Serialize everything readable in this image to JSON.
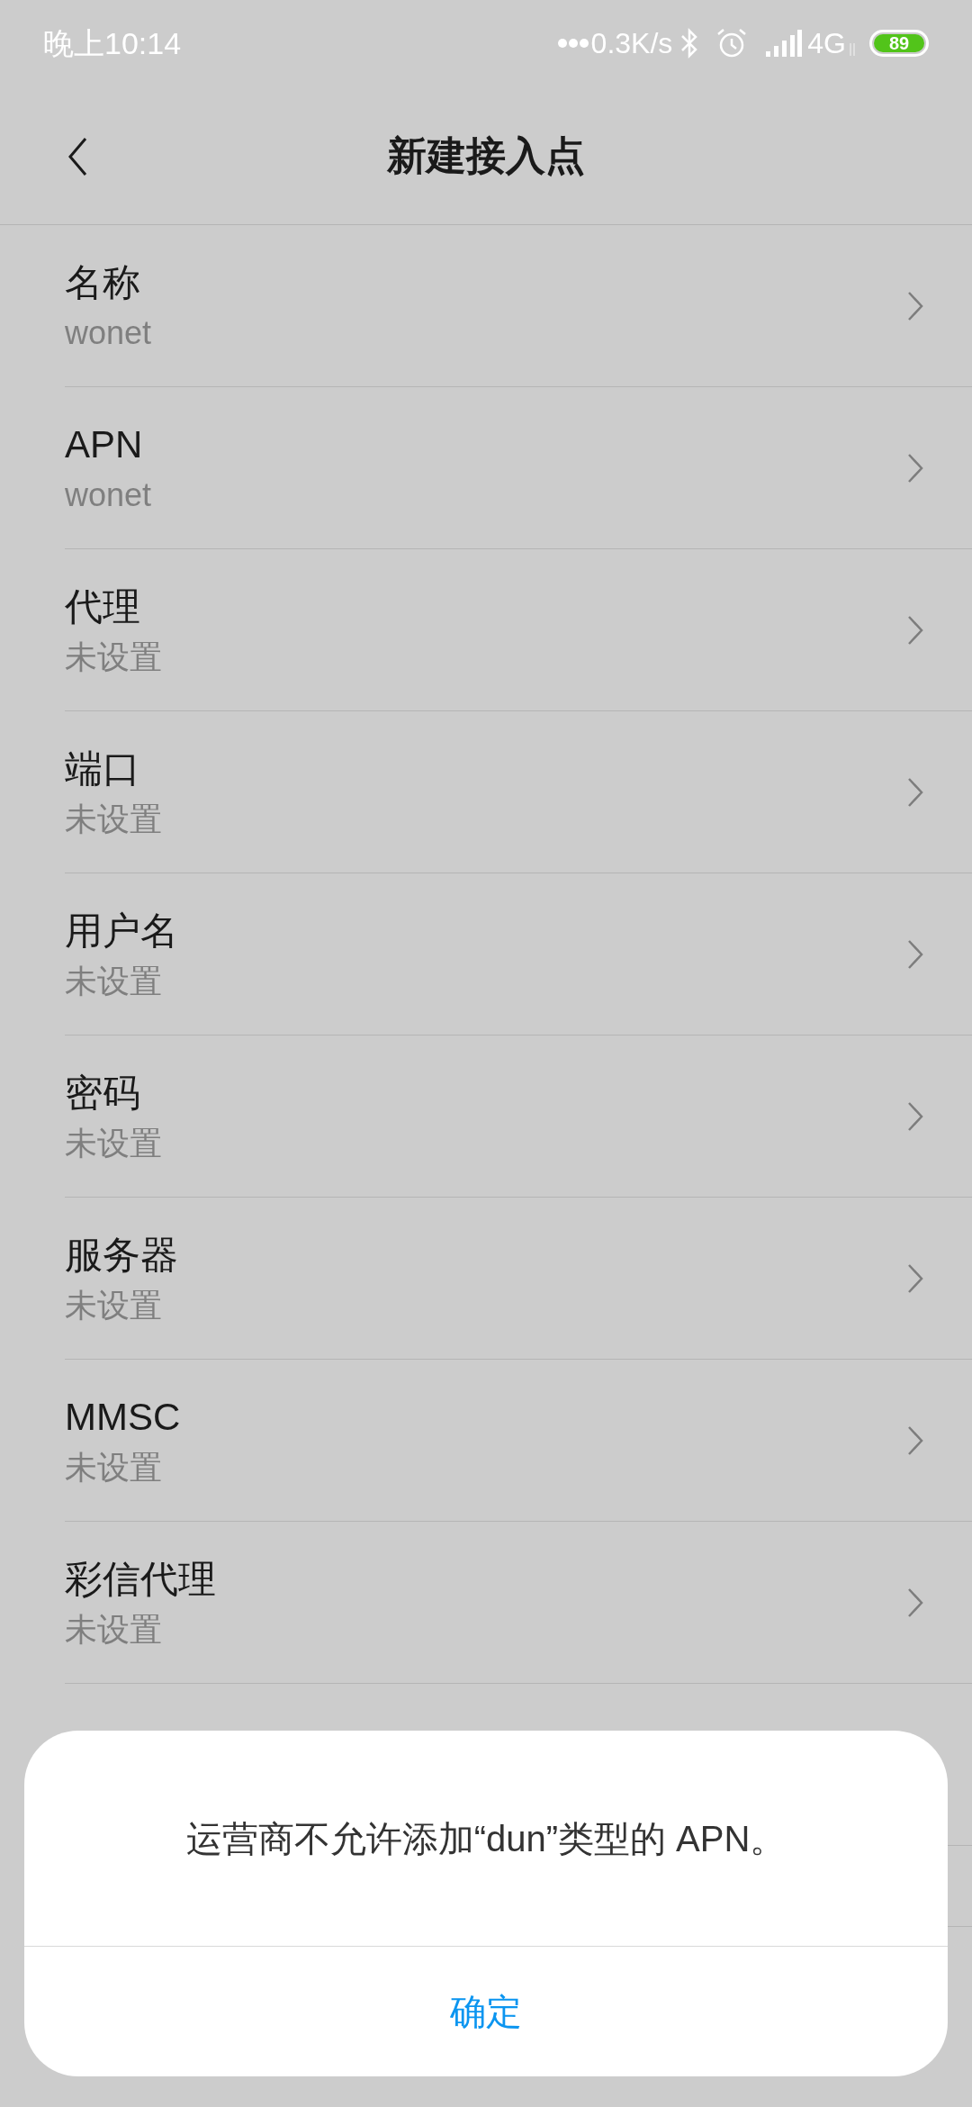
{
  "status_bar": {
    "time": "晚上10:14",
    "speed": "0.3K/s",
    "network": "4G",
    "battery": "89"
  },
  "header": {
    "title": "新建接入点"
  },
  "settings": [
    {
      "label": "名称",
      "value": "wonet"
    },
    {
      "label": "APN",
      "value": "wonet"
    },
    {
      "label": "代理",
      "value": "未设置"
    },
    {
      "label": "端口",
      "value": "未设置"
    },
    {
      "label": "用户名",
      "value": "未设置"
    },
    {
      "label": "密码",
      "value": "未设置"
    },
    {
      "label": "服务器",
      "value": "未设置"
    },
    {
      "label": "MMSC",
      "value": "未设置"
    },
    {
      "label": "彩信代理",
      "value": "未设置"
    }
  ],
  "dialog": {
    "message": "运营商不允许添加“dun”类型的 APN。",
    "button": "确定"
  }
}
